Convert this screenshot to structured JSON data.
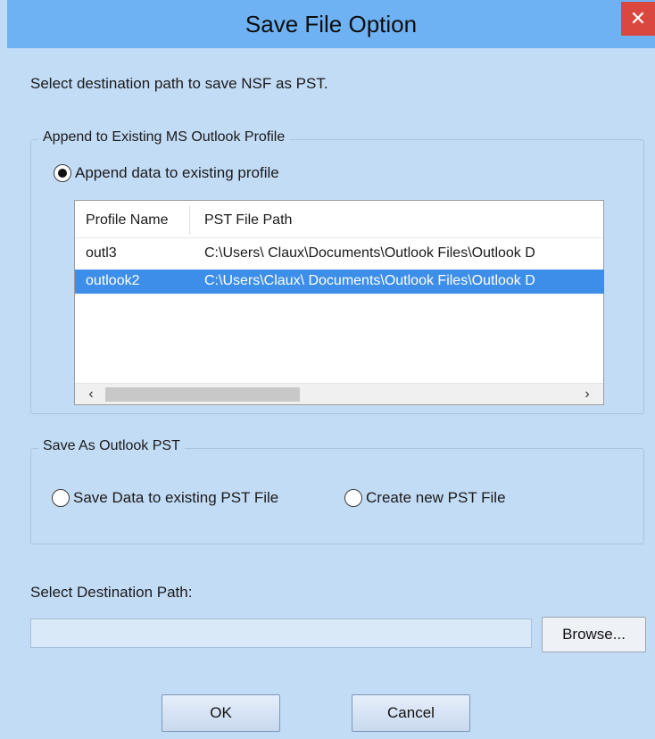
{
  "window": {
    "title": "Save File Option",
    "close_glyph": "✕"
  },
  "instruction": "Select destination path to save NSF as PST.",
  "append_group": {
    "caption": "Append to Existing MS Outlook Profile",
    "radio_label": "Append data to existing profile",
    "radio_checked": true,
    "table": {
      "columns": [
        "Profile Name",
        "PST File Path"
      ],
      "rows": [
        {
          "profile": "outl3",
          "path": "C:\\Users\\ Claux\\Documents\\Outlook Files\\Outlook D",
          "selected": false
        },
        {
          "profile": "outlook2",
          "path": "C:\\Users\\Claux\\ Documents\\Outlook Files\\Outlook D",
          "selected": true
        }
      ],
      "scroll_left_icon": "chevron-left",
      "scroll_right_icon": "chevron-right"
    }
  },
  "save_group": {
    "caption": "Save As Outlook PST",
    "option1": "Save Data to existing PST File",
    "option2": "Create new PST File"
  },
  "destination": {
    "label": "Select Destination Path:",
    "value": "",
    "browse_label": "Browse..."
  },
  "buttons": {
    "ok": "OK",
    "cancel": "Cancel"
  },
  "colors": {
    "background": "#c3dcf5",
    "titlebar": "#6fb2f4",
    "selection": "#3d8ee8",
    "close": "#d9473f"
  }
}
